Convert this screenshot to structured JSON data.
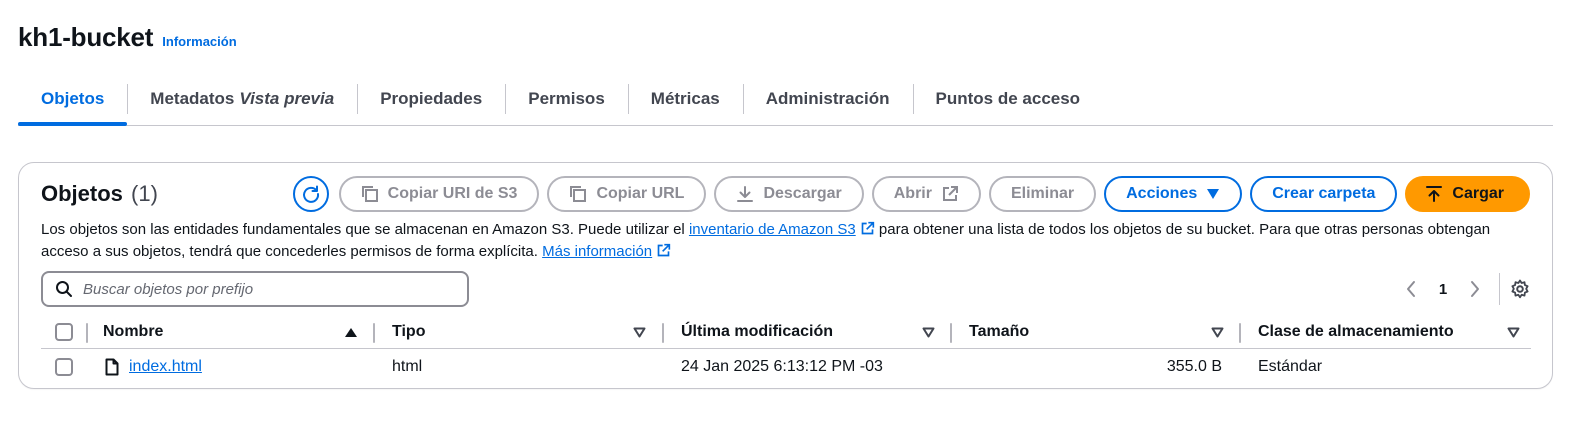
{
  "header": {
    "title": "kh1-bucket",
    "info_link": "Información"
  },
  "tabs": [
    {
      "label": "Objetos",
      "active": true
    },
    {
      "label": "Metadatos",
      "suffix": "Vista previa"
    },
    {
      "label": "Propiedades"
    },
    {
      "label": "Permisos"
    },
    {
      "label": "Métricas"
    },
    {
      "label": "Administración"
    },
    {
      "label": "Puntos de acceso"
    }
  ],
  "objects_panel": {
    "title": "Objetos",
    "count": "(1)",
    "toolbar": {
      "refresh_icon": "refresh-icon",
      "copy_uri": "Copiar URI de S3",
      "copy_url": "Copiar URL",
      "download": "Descargar",
      "open": "Abrir",
      "delete": "Eliminar",
      "actions": "Acciones",
      "create_folder": "Crear carpeta",
      "upload": "Cargar"
    },
    "description": {
      "part1": "Los objetos son las entidades fundamentales que se almacenan en Amazon S3. Puede utilizar el ",
      "link1": "inventario de Amazon S3",
      "part2": " para obtener una lista de todos los objetos de su bucket. Para que otras personas obtengan acceso a sus objetos, tendrá que concederles permisos de forma explícita. ",
      "link2": "Más información"
    },
    "search": {
      "placeholder": "Buscar objetos por prefijo",
      "value": ""
    },
    "pagination": {
      "current_page": "1"
    },
    "table": {
      "columns": {
        "name": "Nombre",
        "type": "Tipo",
        "modified": "Última modificación",
        "size": "Tamaño",
        "storage_class": "Clase de almacenamiento"
      },
      "rows": [
        {
          "name": "index.html",
          "type": "html",
          "modified": "24 Jan 2025 6:13:12 PM -03",
          "size": "355.0 B",
          "storage_class": "Estándar"
        }
      ]
    }
  },
  "colors": {
    "link_blue": "#006ce0",
    "upload_orange": "#ff9900",
    "disabled_gray": "#8c8c94",
    "border_gray": "#c6c6cd",
    "text_dark": "#0f141a"
  }
}
